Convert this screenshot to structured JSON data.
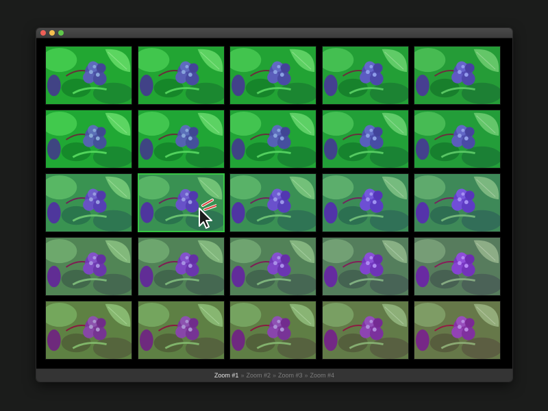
{
  "window": {
    "controls": [
      {
        "name": "close",
        "color": "#ee5f57"
      },
      {
        "name": "minimize",
        "color": "#f4be4f"
      },
      {
        "name": "zoom",
        "color": "#5fc84a"
      }
    ]
  },
  "grid": {
    "rows": 5,
    "cols": 5,
    "selected": {
      "row": 2,
      "col": 1
    },
    "tile_subject": "hydrangea-flower-thumbnail",
    "row_tints": [
      "#00d8a0",
      "#00b878",
      "#7a30ff",
      "#c000c0",
      "#ff2080"
    ],
    "col_tints": [
      "#00c050",
      "#00b060",
      "#10a080",
      "#3080b0",
      "#6060c0"
    ]
  },
  "status_bar": {
    "breadcrumbs": [
      {
        "label": "Zoom #1",
        "active": true
      },
      {
        "label": "Zoom #2",
        "active": false
      },
      {
        "label": "Zoom #3",
        "active": false
      },
      {
        "label": "Zoom #4",
        "active": false
      }
    ],
    "separator": "»"
  }
}
